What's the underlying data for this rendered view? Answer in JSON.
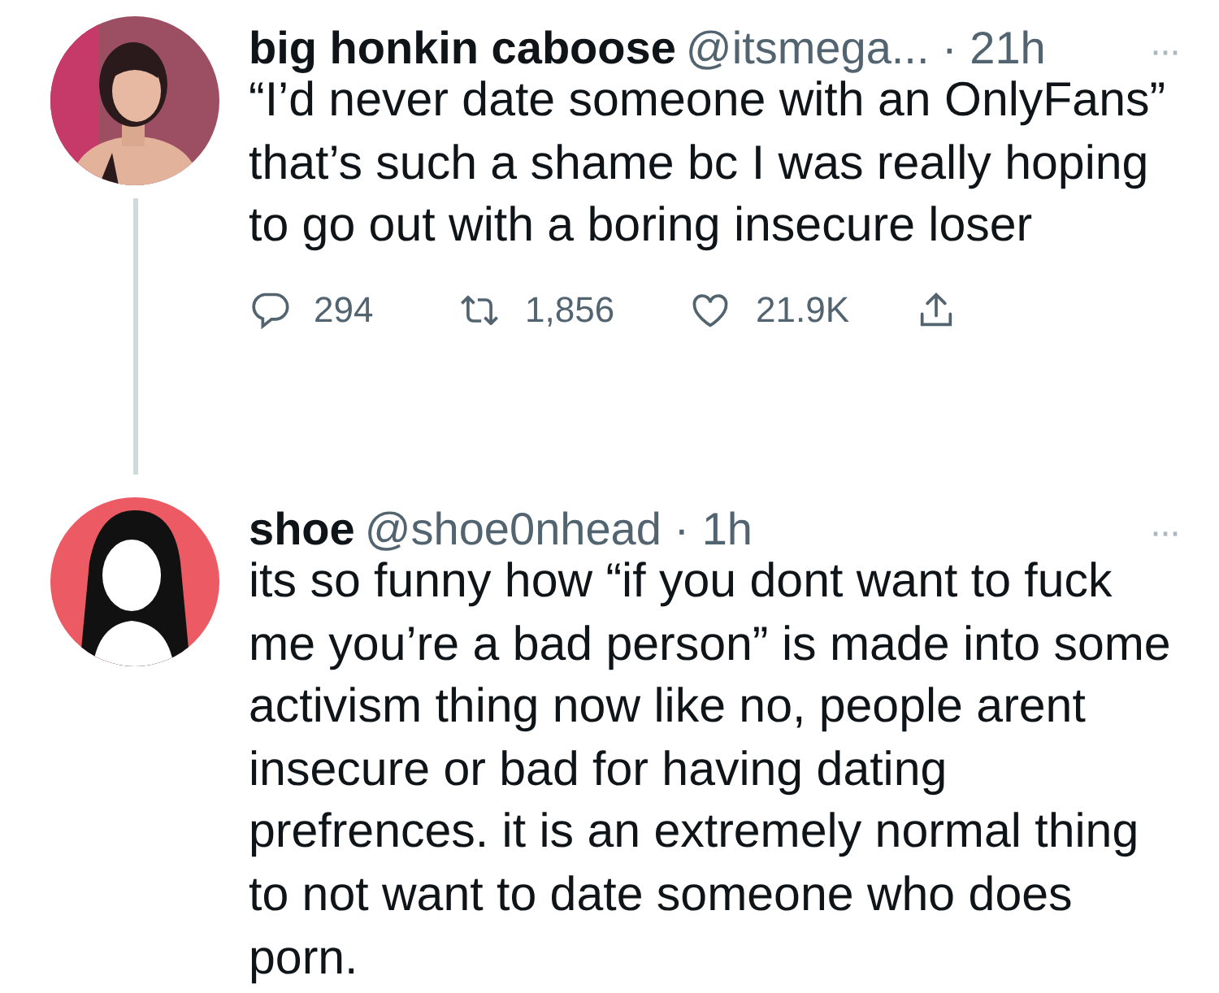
{
  "tweets": [
    {
      "thread_line": true,
      "name": "big honkin caboose",
      "handle": "@itsmega...",
      "time": "· 21h",
      "more": "···",
      "text": "“I’d never date someone with an OnlyFans” that’s such a shame bc I was really hoping to go out with a boring insecure loser",
      "actions": [
        {
          "kind": "reply",
          "count": "294"
        },
        {
          "kind": "retweet",
          "count": "1,856"
        },
        {
          "kind": "like",
          "count": "21.9K"
        },
        {
          "kind": "share"
        }
      ]
    },
    {
      "avatar": {
        "kind": "silhouette"
      },
      "thread_line": false,
      "name": "shoe",
      "handle": "@shoe0nhead",
      "time": "· 1h",
      "more": "···",
      "text": "its so funny how “if you dont want to fuck me you’re a bad person” is made into some activism thing now like no, people arent insecure or bad for having dating prefrences. it is an extremely normal thing to not want to date someone who does porn."
    }
  ]
}
